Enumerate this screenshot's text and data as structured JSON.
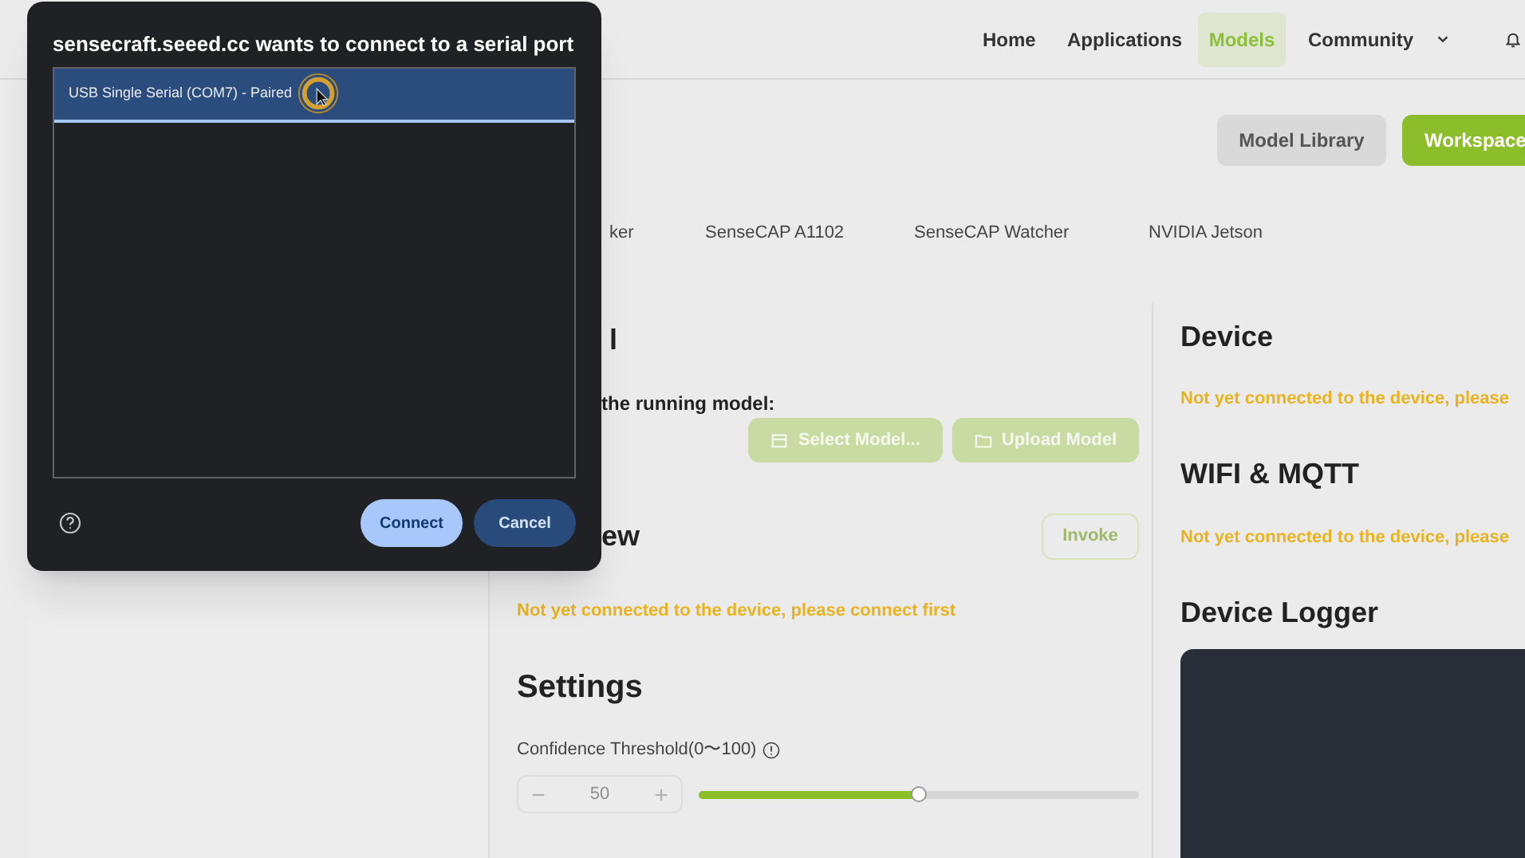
{
  "nav": {
    "items": [
      {
        "label": "Home",
        "kind": "link",
        "selected": false
      },
      {
        "label": "Applications",
        "kind": "link",
        "selected": false
      },
      {
        "label": "Models",
        "kind": "link",
        "selected": true
      },
      {
        "label": "Community",
        "kind": "dropdown",
        "selected": false
      }
    ]
  },
  "header_buttons": [
    {
      "label": "Model Library",
      "selected": false
    },
    {
      "label": "Workspace",
      "selected": true
    }
  ],
  "device_tabs": [
    "ker",
    "SenseCAP A1102",
    "SenseCAP Watcher",
    "NVIDIA Jetson"
  ],
  "model_panel": {
    "title": "l",
    "prompt": "the running model:",
    "buttons": [
      {
        "label": "Select Model...",
        "kind": "store",
        "disabled": true
      },
      {
        "label": "Upload Model",
        "kind": "folder",
        "disabled": true
      }
    ]
  },
  "preview": {
    "title": "ew",
    "invoke": {
      "label": "Invoke",
      "disabled": true
    },
    "warning": "Not yet connected to the device, please connect first"
  },
  "settings": {
    "title": "Settings",
    "threshold": {
      "label": "Confidence Threshold(0〜100)",
      "value": "50",
      "level": 0.5,
      "disabled": true
    }
  },
  "device": {
    "title": "Device",
    "warning": "Not yet connected to the device, please"
  },
  "wifi": {
    "title": "WIFI & MQTT",
    "warning": "Not yet connected to the device, please"
  },
  "logger": {
    "title": "Device Logger"
  },
  "dialog": {
    "title": "sensecraft.seeed.cc wants to connect to a serial port",
    "ports": [
      {
        "label": "USB Single Serial (COM7) - Paired",
        "selected": true
      }
    ],
    "buttons": [
      {
        "label": "Connect",
        "kind": "primary"
      },
      {
        "label": "Cancel",
        "kind": "secondary"
      }
    ]
  }
}
